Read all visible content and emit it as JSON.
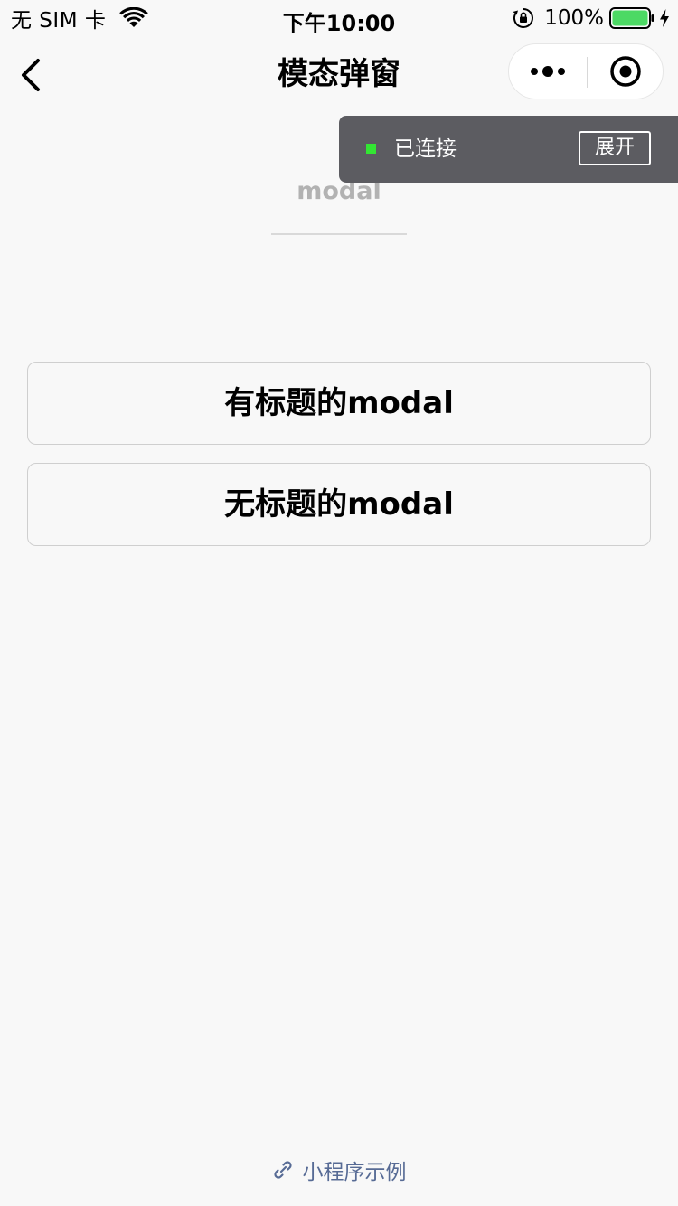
{
  "status_bar": {
    "carrier": "无 SIM 卡",
    "time": "下午10:00",
    "battery_percent": "100%",
    "battery_level": 1.0,
    "battery_color": "#4cd964",
    "icons": [
      "wifi-icon",
      "rotation-lock-icon",
      "battery-icon",
      "charging-icon"
    ]
  },
  "nav": {
    "title": "模态弹窗",
    "back_icon": "chevron-left-icon",
    "capsule": {
      "more_icon": "more-dots-icon",
      "close_icon": "target-circle-icon"
    }
  },
  "page": {
    "heading": "modal"
  },
  "connection_panel": {
    "status": "已连接",
    "status_color": "#33e633",
    "expand_label": "展开"
  },
  "buttons": [
    {
      "label": "有标题的modal"
    },
    {
      "label": "无标题的modal"
    }
  ],
  "footer": {
    "label": "小程序示例",
    "icon": "link-icon",
    "color": "#576b95"
  }
}
